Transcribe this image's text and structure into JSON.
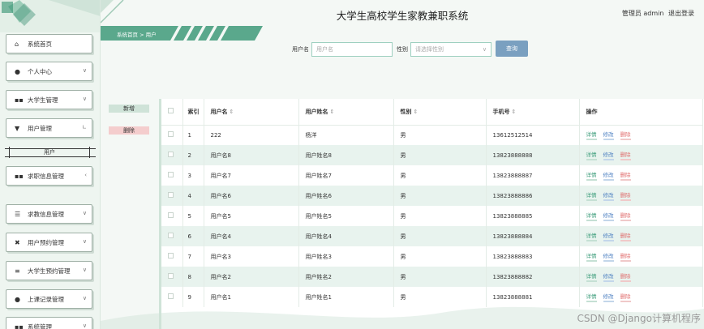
{
  "app": {
    "title": "大学生高校学生家教兼职系统",
    "user_label": "管理员 admin",
    "logout_label": "退出登录"
  },
  "breadcrumb": {
    "home": "系统首页",
    "separator": ">",
    "current": "用户"
  },
  "sidebar": {
    "items": [
      {
        "label": "系统首页",
        "icon": "home-icon"
      },
      {
        "label": "个人中心",
        "icon": "person-icon"
      },
      {
        "label": "大学生管理",
        "icon": "grid-icon"
      },
      {
        "label": "用户管理",
        "icon": "badge-icon"
      },
      {
        "label": "求职信息管理",
        "icon": "grid-icon"
      },
      {
        "label": "求教信息管理",
        "icon": "sliders-icon"
      },
      {
        "label": "用户预约管理",
        "icon": "ticket-icon"
      },
      {
        "label": "大学生预约管理",
        "icon": "list-icon"
      },
      {
        "label": "上课记录管理",
        "icon": "person-icon"
      },
      {
        "label": "系统管理",
        "icon": "grid-icon"
      }
    ],
    "submenu": {
      "label": "用户"
    }
  },
  "search": {
    "username_label": "用户名",
    "username_placeholder": "用户名",
    "gender_label": "性别",
    "gender_placeholder": "请选择性别",
    "query_label": "查询"
  },
  "actions": {
    "add_label": "新增",
    "delete_label": "删除"
  },
  "table": {
    "headers": {
      "index": "索引",
      "username": "用户名",
      "name": "用户姓名",
      "gender": "性别",
      "phone": "手机号",
      "ops": "操作"
    },
    "row_actions": {
      "detail": "详情",
      "edit": "修改",
      "delete": "删除"
    },
    "rows": [
      {
        "index": "1",
        "username": "222",
        "name": "杨洋",
        "gender": "男",
        "phone": "13612512514"
      },
      {
        "index": "2",
        "username": "用户名8",
        "name": "用户姓名8",
        "gender": "男",
        "phone": "13823888888"
      },
      {
        "index": "3",
        "username": "用户名7",
        "name": "用户姓名7",
        "gender": "男",
        "phone": "13823888887"
      },
      {
        "index": "4",
        "username": "用户名6",
        "name": "用户姓名6",
        "gender": "男",
        "phone": "13823888886"
      },
      {
        "index": "5",
        "username": "用户名5",
        "name": "用户姓名5",
        "gender": "男",
        "phone": "13823888885"
      },
      {
        "index": "6",
        "username": "用户名4",
        "name": "用户姓名4",
        "gender": "男",
        "phone": "13823888884"
      },
      {
        "index": "7",
        "username": "用户名3",
        "name": "用户姓名3",
        "gender": "男",
        "phone": "13823888883"
      },
      {
        "index": "8",
        "username": "用户名2",
        "name": "用户姓名2",
        "gender": "男",
        "phone": "13823888882"
      },
      {
        "index": "9",
        "username": "用户名1",
        "name": "用户姓名1",
        "gender": "男",
        "phone": "13823888881"
      }
    ]
  },
  "watermark": "CSDN @Django计算机程序",
  "colors": {
    "accent": "#2e8f6e",
    "band": "#5aa88c",
    "row_alt": "#e8f3ee",
    "query": "#7aa0c0"
  }
}
